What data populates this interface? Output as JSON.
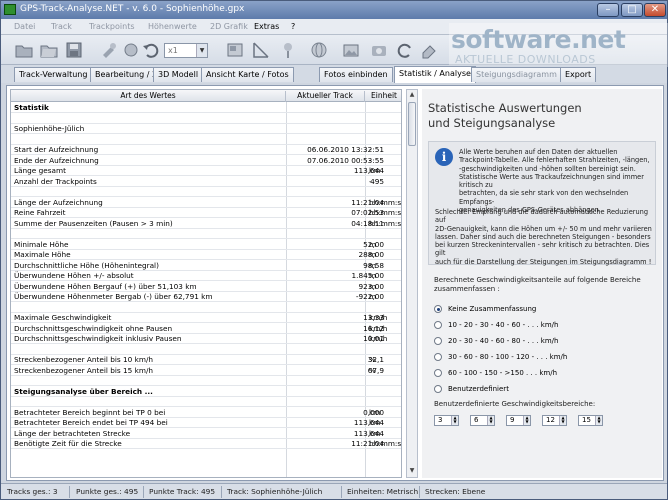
{
  "window": {
    "title": "GPS-Track-Analyse.NET  -  v. 6.0  -  Sophienhöhe.gpx"
  },
  "menu": [
    "Datei",
    "Track",
    "Trackpoints",
    "Höhenwerte",
    "2D Grafik",
    "Extras",
    "?"
  ],
  "toolbar": {
    "zoom_value": "x1"
  },
  "watermark": {
    "line1": "software.net",
    "line2": "AKTUELLE DOWNLOADS"
  },
  "tabs": [
    {
      "label": "Track-Verwaltung"
    },
    {
      "label": "Bearbeitung / 2D Modell"
    },
    {
      "label": "3D Modell"
    },
    {
      "label": "Ansicht Karte / Fotos"
    },
    {
      "label": "Fotos einbinden"
    },
    {
      "label": "Statistik / Analyse"
    },
    {
      "label": "Steigungsdiagramm"
    },
    {
      "label": "Export"
    }
  ],
  "grid": {
    "headers": [
      "Art des Wertes",
      "Aktueller Track",
      "Einheit"
    ],
    "rows": [
      {
        "name": "Statistik",
        "value": "",
        "unit": "",
        "bold": true
      },
      {
        "name": "",
        "value": "",
        "unit": ""
      },
      {
        "name": "Sophienhöhe-Jülich",
        "value": "",
        "unit": ""
      },
      {
        "name": "",
        "value": "",
        "unit": ""
      },
      {
        "name": "Start der Aufzeichnung",
        "value": "06.06.2010 13:32:51",
        "unit": "-"
      },
      {
        "name": "Ende der Aufzeichnung",
        "value": "07.06.2010 00:53:55",
        "unit": "-"
      },
      {
        "name": "Länge gesamt",
        "value": "113,644",
        "unit": "km"
      },
      {
        "name": "Anzahl der Trackpoints",
        "value": "495",
        "unit": "-"
      },
      {
        "name": "",
        "value": "",
        "unit": ""
      },
      {
        "name": "Länge der Aufzeichnung",
        "value": "11:21:04",
        "unit": "hh:mm:ss"
      },
      {
        "name": "Reine Fahrzeit",
        "value": "07:02:53",
        "unit": "hh:mm:ss"
      },
      {
        "name": "Summe der Pausenzeiten (Pausen > 3 min)",
        "value": "04:18:11",
        "unit": "hh:mm:ss"
      },
      {
        "name": "",
        "value": "",
        "unit": ""
      },
      {
        "name": "Minimale Höhe",
        "value": "52,00",
        "unit": "m"
      },
      {
        "name": "Maximale Höhe",
        "value": "288,00",
        "unit": "m"
      },
      {
        "name": "Durchschnittliche Höhe (Höhenintegral)",
        "value": "98,58",
        "unit": "m"
      },
      {
        "name": "Überwundene Höhen +/- absolut",
        "value": "1.845,00",
        "unit": "m"
      },
      {
        "name": "Überwundene Höhen Bergauf (+)  über 51,103 km",
        "value": "923,00",
        "unit": "m"
      },
      {
        "name": "Überwundene Höhenmeter Bergab (-)  über 62,791 km",
        "value": "-922,00",
        "unit": "m"
      },
      {
        "name": "",
        "value": "",
        "unit": ""
      },
      {
        "name": "Maximale Geschwindigkeit",
        "value": "13,33",
        "unit": "km/h"
      },
      {
        "name": "Durchschnittsgeschwindigkeit ohne Pausen",
        "value": "16,12",
        "unit": "km/h"
      },
      {
        "name": "Durchschnittsgeschwindigkeit inklusiv Pausen",
        "value": "10,01",
        "unit": "km/h"
      },
      {
        "name": "",
        "value": "",
        "unit": ""
      },
      {
        "name": "Streckenbezogener Anteil      bis      10 km/h",
        "value": "32,1",
        "unit": "%"
      },
      {
        "name": "Streckenbezogener Anteil      bis      15 km/h",
        "value": "67,9",
        "unit": "%"
      },
      {
        "name": "",
        "value": "",
        "unit": ""
      },
      {
        "name": "Steigungsanalyse über Bereich ...",
        "value": "",
        "unit": "",
        "bold": true
      },
      {
        "name": "",
        "value": "",
        "unit": ""
      },
      {
        "name": "Betrachteter Bereich beginnt bei      TP 0   bei",
        "value": "0,000",
        "unit": "km"
      },
      {
        "name": "Betrachteter Bereich endet bei         TP 494  bei",
        "value": "113,644",
        "unit": "km"
      },
      {
        "name": "Länge der betrachteten Strecke",
        "value": "113,644",
        "unit": "km"
      },
      {
        "name": "Benötigte Zeit für die Strecke",
        "value": "11:21:04",
        "unit": "hh:mm:ss"
      }
    ]
  },
  "panel": {
    "heading1": "Statistische Auswertungen",
    "heading2": "und Steigungsanalyse",
    "info_p1": [
      "Alle Werte beruhen auf den Daten der aktuellen",
      "Trackpoint-Tabelle. Alle fehlerhaften Strahlzeiten, -längen,",
      "-geschwindigkeiten und -höhen sollten bereinigt sein.",
      "Statistische Werte aus Trackaufzeichnungen sind immer kritisch zu",
      "betrachten, da sie sehr stark von den wechselnden Empfangs-",
      "genauigkeiten des GPS-Gerätes abhängen."
    ],
    "info_p2": [
      "Schlechter Empfang und die dadurch automatische Reduzierung auf",
      "2D-Genauigkeit, kann die Höhen um +/- 50 m und mehr variieren",
      "lassen. Daher sind auch die berechneten Steigungen - besonders",
      "bei kurzen Streckenintervallen - sehr kritisch zu betrachten. Dies gilt",
      "auch für die Darstellung der Steigungen im Steigungsdiagramm !"
    ],
    "speed_label1": "Berechnete Geschwindigkeitsanteile auf folgende Bereiche",
    "speed_label2": "zusammenfassen :",
    "options": [
      {
        "label": "Keine Zusammenfassung",
        "selected": true
      },
      {
        "label": "10   -   20   -   30   -   40   -   60   -   . . .    km/h",
        "selected": false
      },
      {
        "label": "20   -   30   -   40   -   60   -   80   -   . . .    km/h",
        "selected": false
      },
      {
        "label": "30   -   60   -   80   -  100  - 120   -   . . .    km/h",
        "selected": false
      },
      {
        "label": "60   - 100  - 150   - >150              . . .    km/h",
        "selected": false
      },
      {
        "label": "Benutzerdefiniert",
        "selected": false
      }
    ],
    "custom_label": "Benutzerdefinierte Geschwindigkeitsbereiche:",
    "spinners": [
      "3",
      "6",
      "9",
      "12",
      "15"
    ]
  },
  "status": [
    "Tracks ges.: 3",
    "Punkte ges.: 495",
    "Punkte Track: 495",
    "Track: Sophienhöhe-Jülich",
    "Einheiten: Metrisch",
    "Strecken: Ebene"
  ]
}
